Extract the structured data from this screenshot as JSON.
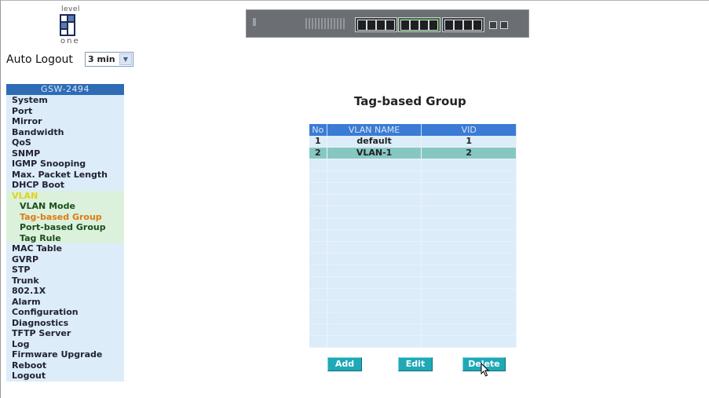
{
  "logo": {
    "top_text": "level",
    "bottom_text": "one"
  },
  "auto_logout": {
    "label": "Auto Logout",
    "value": "3 min"
  },
  "sidebar": {
    "header": "GSW-2494",
    "items": [
      {
        "label": "System",
        "type": "item"
      },
      {
        "label": "Port",
        "type": "item"
      },
      {
        "label": "Mirror",
        "type": "item"
      },
      {
        "label": "Bandwidth",
        "type": "item"
      },
      {
        "label": "QoS",
        "type": "item"
      },
      {
        "label": "SNMP",
        "type": "item"
      },
      {
        "label": "IGMP Snooping",
        "type": "item"
      },
      {
        "label": "Max. Packet Length",
        "type": "item"
      },
      {
        "label": "DHCP Boot",
        "type": "item"
      },
      {
        "label": "VLAN",
        "type": "active-parent"
      },
      {
        "label": "VLAN Mode",
        "type": "sub"
      },
      {
        "label": "Tag-based Group",
        "type": "sub current"
      },
      {
        "label": "Port-based Group",
        "type": "sub"
      },
      {
        "label": "Tag Rule",
        "type": "sub"
      },
      {
        "label": "MAC Table",
        "type": "item"
      },
      {
        "label": "GVRP",
        "type": "item"
      },
      {
        "label": "STP",
        "type": "item"
      },
      {
        "label": "Trunk",
        "type": "item"
      },
      {
        "label": "802.1X",
        "type": "item"
      },
      {
        "label": "Alarm",
        "type": "item"
      },
      {
        "label": "Configuration",
        "type": "item"
      },
      {
        "label": "Diagnostics",
        "type": "item"
      },
      {
        "label": "TFTP Server",
        "type": "item"
      },
      {
        "label": "Log",
        "type": "item"
      },
      {
        "label": "Firmware Upgrade",
        "type": "item"
      },
      {
        "label": "Reboot",
        "type": "item"
      },
      {
        "label": "Logout",
        "type": "item"
      }
    ]
  },
  "main": {
    "title": "Tag-based Group",
    "columns": [
      "No",
      "VLAN NAME",
      "VID"
    ],
    "rows": [
      {
        "no": "1",
        "name": "default",
        "vid": "1",
        "selected": false
      },
      {
        "no": "2",
        "name": "VLAN-1",
        "vid": "2",
        "selected": true
      }
    ],
    "empty_rows": 16,
    "buttons": {
      "add": "Add",
      "edit": "Edit",
      "delete": "Delete"
    }
  },
  "colors": {
    "sidebar_bg": "#dcecf8",
    "submenu_bg": "#dbf1dc",
    "header_blue": "#3a7bd5",
    "selected_row": "#87c7c2",
    "button": "#1fa9b7",
    "current_item": "#e07a10"
  },
  "icons": {
    "logo": "levelone-logo",
    "device": "switch-front-panel-image",
    "select_arrow": "chevron-down-icon",
    "pointer": "mouse-cursor-icon"
  }
}
